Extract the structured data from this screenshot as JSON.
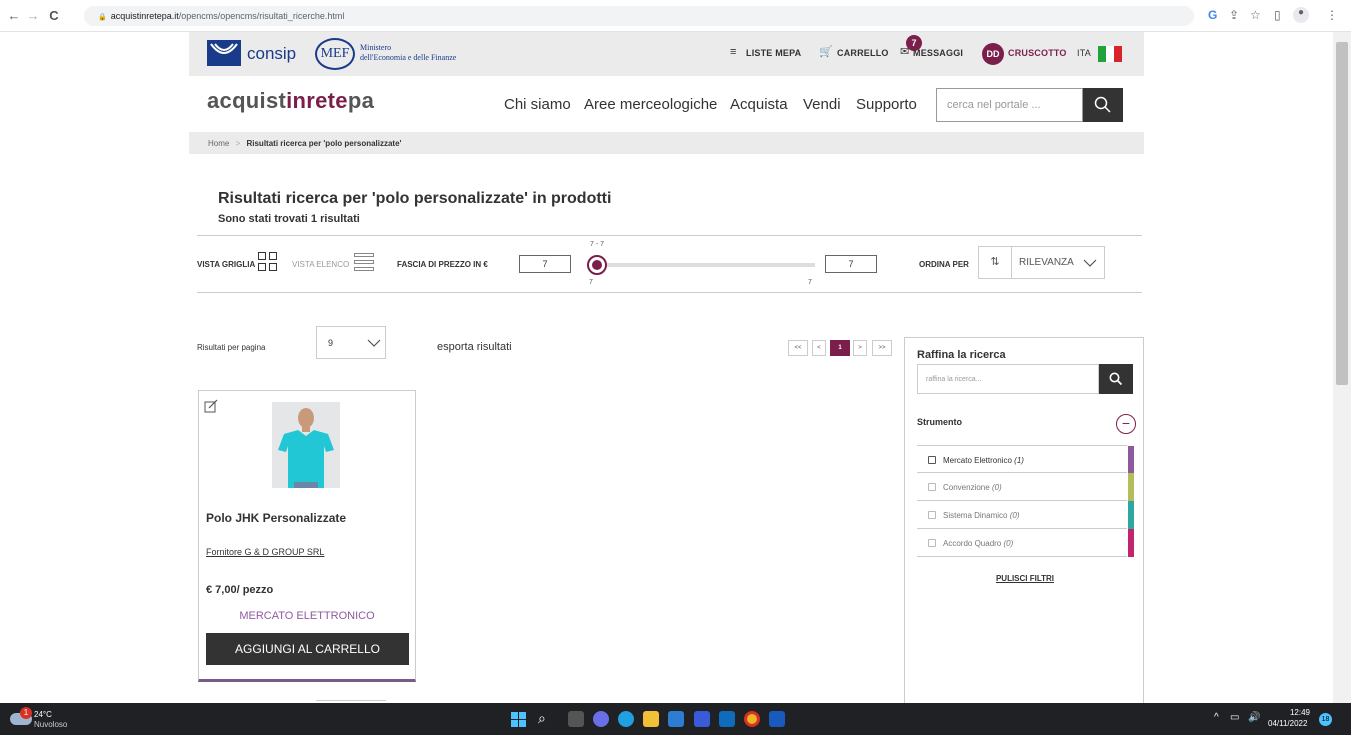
{
  "browser": {
    "url_host": "acquistinretepa.it",
    "url_path": "/opencms/opencms/risultati_ricerche.html",
    "back_icon": "←",
    "forward_icon": "→",
    "reload_icon": "C",
    "lock_icon": "🔒"
  },
  "topbar": {
    "consip_label": "consip",
    "mef_label": "MEF",
    "ministero_line1": "Ministero",
    "ministero_line2": "dell'Economia e delle Finanze",
    "liste_mepa": "LISTE MEPA",
    "carrello": "CARRELLO",
    "messaggi": "MESSAGGI",
    "messaggi_count": "7",
    "avatar_initials": "DD",
    "cruscotto": "CRUSCOTTO",
    "lang": "ITA"
  },
  "header": {
    "brand_pre": "acquist",
    "brand_mid": "inrete",
    "brand_post": "pa",
    "nav": [
      "Chi siamo",
      "Aree merceologiche",
      "Acquista",
      "Vendi",
      "Supporto"
    ],
    "search_placeholder": "cerca nel portale ..."
  },
  "breadcrumb": {
    "home": "Home",
    "sep": ">",
    "current": "Risultati ricerca per 'polo personalizzate'"
  },
  "results": {
    "title": "Risultati ricerca per 'polo personalizzate' in prodotti",
    "subtitle": "Sono stati trovati 1 risultati"
  },
  "toolbar": {
    "vista_griglia": "VISTA GRIGLIA",
    "vista_elenco": "VISTA ELENCO",
    "fascia_prezzo": "FASCIA DI PREZZO IN €",
    "price_min": "7",
    "price_max": "7",
    "range_label": "7 - 7",
    "range_min_tick": "7",
    "range_max_tick": "7",
    "ordina_per": "ORDINA PER",
    "sort_value": "RILEVANZA"
  },
  "listing": {
    "per_page_label": "Risultati per pagina",
    "per_page_value": "9",
    "export": "esporta risultati",
    "pagination": [
      "<<",
      "<",
      "1",
      ">",
      ">>"
    ]
  },
  "product": {
    "name": "Polo JHK Personalizzate",
    "supplier": "Fornitore G & D GROUP SRL",
    "price": "€ 7,00/ pezzo",
    "channel": "MERCATO ELETTRONICO",
    "add_to_cart": "AGGIUNGI AL CARRELLO"
  },
  "filters": {
    "title": "Raffina la ricerca",
    "search_placeholder": "raffina la ricerca...",
    "section": "Strumento",
    "items": [
      {
        "label": "Mercato Elettronico",
        "count": "(1)",
        "color": "#8e5a9e"
      },
      {
        "label": "Convenzione",
        "count": "(0)",
        "color": "#b5bd5a"
      },
      {
        "label": "Sistema Dinamico",
        "count": "(0)",
        "color": "#2fa6a0"
      },
      {
        "label": "Accordo Quadro",
        "count": "(0)",
        "color": "#c2256b"
      }
    ],
    "clear": "PULISCI FILTRI"
  },
  "taskbar": {
    "weather_temp": "24°C",
    "weather_desc": "Nuvoloso",
    "weather_badge": "1",
    "time": "12:49",
    "date": "04/11/2022",
    "notif": "18"
  },
  "colors": {
    "accent": "#7a1f4b",
    "channel": "#8e5a9e",
    "dark": "#333333"
  }
}
